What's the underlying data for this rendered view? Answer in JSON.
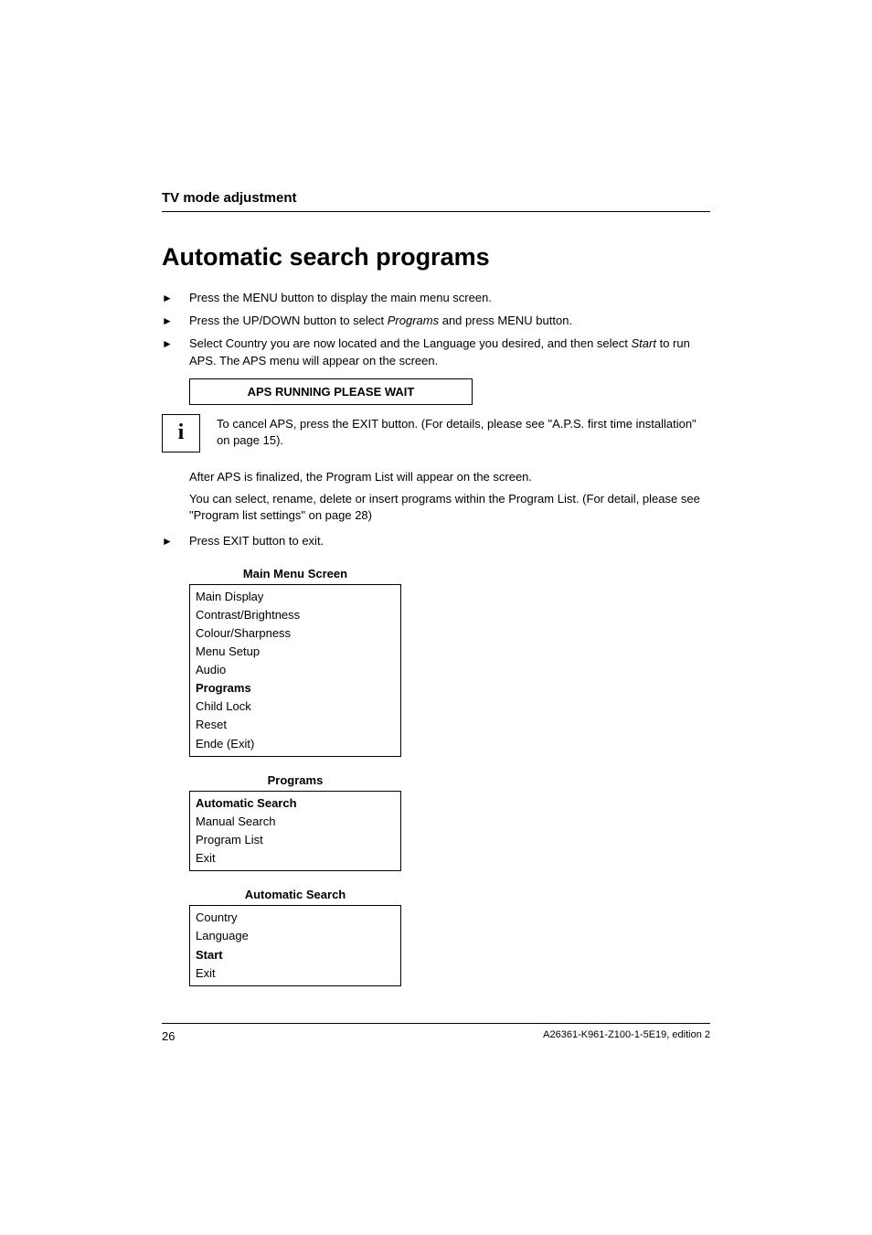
{
  "header": {
    "title": "TV mode adjustment"
  },
  "main": {
    "title": "Automatic search programs"
  },
  "steps": {
    "step1": "Press the MENU button to display the main menu screen.",
    "step2_a": "Press the UP/DOWN button to select ",
    "step2_i": "Programs",
    "step2_b": " and press MENU button.",
    "step3_a": "Select Country you are now located and the Language you desired, and then select ",
    "step3_i": "Start",
    "step3_b": " to run APS. The APS menu will appear on the screen."
  },
  "aps_banner": "APS RUNNING PLEASE WAIT",
  "info_icon": "i",
  "info_text": "To cancel APS, press the EXIT button. (For details, please see \"A.P.S. first time installation\" on page 15).",
  "after": {
    "p1": "After APS is finalized, the Program List will appear on the screen.",
    "p2": "You can select, rename, delete or insert programs within the Program List. (For detail, please see \"Program list settings\" on page 28)"
  },
  "exit_step": "Press EXIT button to exit.",
  "menus": {
    "main_menu": {
      "title": "Main Menu Screen",
      "items": [
        "Main Display",
        "Contrast/Brightness",
        "Colour/Sharpness",
        "Menu Setup",
        "Audio",
        "Programs",
        "Child Lock",
        "Reset",
        "Ende (Exit)"
      ],
      "selected_index": 5
    },
    "programs_menu": {
      "title": "Programs",
      "items": [
        "Automatic Search",
        "Manual Search",
        "Program List",
        "Exit"
      ],
      "selected_index": 0
    },
    "auto_search_menu": {
      "title": "Automatic Search",
      "items": [
        "Country",
        "Language",
        "Start",
        "Exit"
      ],
      "selected_index": 2
    }
  },
  "footer": {
    "page": "26",
    "doc_id": "A26361-K961-Z100-1-5E19, edition 2"
  }
}
